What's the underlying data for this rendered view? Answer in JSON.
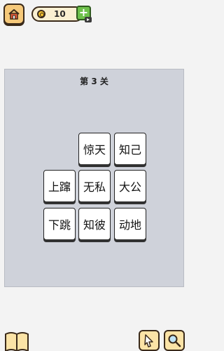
{
  "header": {
    "coins": "10",
    "add_label": "+"
  },
  "level": {
    "title": "第 3 关"
  },
  "tiles": [
    "惊天",
    "知己",
    "上蹿",
    "无私",
    "大公",
    "下跳",
    "知彼",
    "动地"
  ],
  "toolbar": {
    "book_icon": "book-icon",
    "hint_icon": "pointer-icon",
    "search_icon": "magnifier-icon"
  },
  "colors": {
    "board": "#cfd2da",
    "background": "#f3f3f3",
    "add_button": "#6dc04a",
    "home_button": "#f6c97a"
  }
}
